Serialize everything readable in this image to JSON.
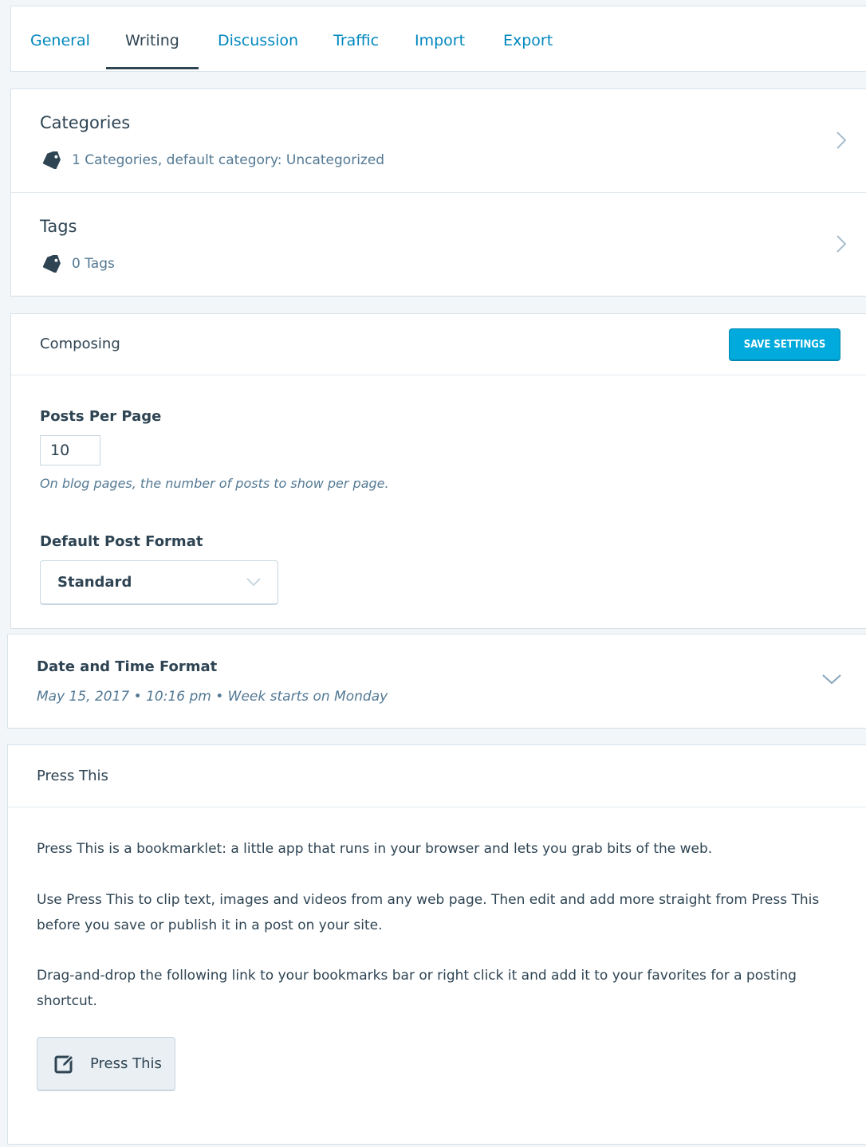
{
  "tabs": {
    "items": [
      {
        "label": "General"
      },
      {
        "label": "Writing"
      },
      {
        "label": "Discussion"
      },
      {
        "label": "Traffic"
      },
      {
        "label": "Import"
      },
      {
        "label": "Export"
      }
    ],
    "selected": "Writing"
  },
  "taxonomies": {
    "categories": {
      "title": "Categories",
      "summary": "1 Categories, default category: Uncategorized"
    },
    "tags": {
      "title": "Tags",
      "summary": "0 Tags"
    }
  },
  "composing": {
    "header": "Composing",
    "save_label": "Save Settings",
    "posts_per_page": {
      "label": "Posts Per Page",
      "value": "10",
      "explanation": "On blog pages, the number of posts to show per page."
    },
    "default_post_format": {
      "label": "Default Post Format",
      "value": "Standard"
    }
  },
  "date_time": {
    "title": "Date and Time Format",
    "summary": "May 15, 2017 • 10:16 pm • Week starts on Monday"
  },
  "press_this": {
    "header": "Press This",
    "paragraphs": [
      "Press This is a bookmarklet: a little app that runs in your browser and lets you grab bits of the web.",
      "Use Press This to clip text, images and videos from any web page. Then edit and add more straight from Press This before you save or publish it in a post on your site.",
      "Drag-and-drop the following link to your bookmarks bar or right click it and add it to your favorites for a posting shortcut."
    ],
    "button_label": "Press This"
  },
  "colors": {
    "link": "#0087be",
    "text": "#2e4453",
    "muted": "#537994",
    "primary_button": "#00aadc",
    "background": "#f3f6f8"
  },
  "icons": {
    "tag": "tag-icon",
    "chevron_right": "chevron-right-icon",
    "chevron_down": "chevron-down-icon",
    "edit": "edit-icon"
  }
}
